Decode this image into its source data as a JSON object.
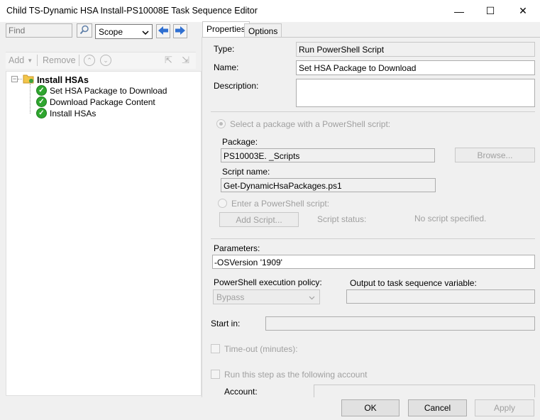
{
  "window": {
    "title": "Child TS-Dynamic HSA Install-PS10008E Task Sequence Editor",
    "min": "—",
    "max": "☐",
    "close": "✕"
  },
  "toolbar": {
    "find_placeholder": "Find",
    "scope_value": "Scope",
    "add_label": "Add",
    "remove_label": "Remove"
  },
  "tree": {
    "group_label": "Install HSAs",
    "items": [
      {
        "label": "Set HSA Package to Download"
      },
      {
        "label": "Download Package Content"
      },
      {
        "label": "Install HSAs"
      }
    ]
  },
  "tabs": [
    {
      "label": "Properties"
    },
    {
      "label": "Options"
    }
  ],
  "properties": {
    "type_label": "Type:",
    "type_value": "Run PowerShell Script",
    "name_label": "Name:",
    "name_value": "Set HSA Package to Download",
    "description_label": "Description:",
    "description_value": "",
    "select_package_label": "Select a package with a PowerShell script:",
    "package_label": "Package:",
    "package_value": "PS10003E. _Scripts",
    "browse_label": "Browse...",
    "script_name_label": "Script name:",
    "script_name_value": "Get-DynamicHsaPackages.ps1",
    "enter_script_label": "Enter a PowerShell script:",
    "add_script_label": "Add Script...",
    "script_status_label": "Script status:",
    "script_status_value": "No script specified.",
    "parameters_label": "Parameters:",
    "parameters_value": "-OSVersion '1909'",
    "policy_label": "PowerShell execution policy:",
    "policy_value": "Bypass",
    "output_label": "Output to task sequence variable:",
    "output_value": "",
    "start_in_label": "Start in:",
    "start_in_value": "",
    "timeout_label": "Time-out (minutes):",
    "run_as_label": "Run this step as the following account",
    "account_label": "Account:",
    "account_value": ""
  },
  "footer": {
    "ok_label": "OK",
    "cancel_label": "Cancel",
    "apply_label": "Apply"
  }
}
